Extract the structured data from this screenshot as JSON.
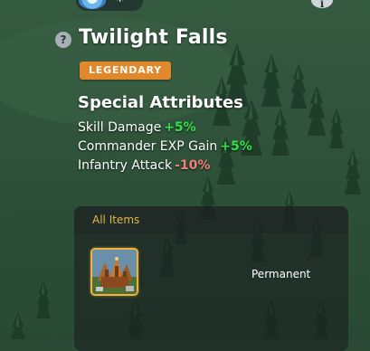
{
  "artifact": {
    "name": "Twilight Falls",
    "rarity": "LEGENDARY",
    "rarity_color": "#e0882a"
  },
  "attributes": {
    "heading": "Special Attributes",
    "items": [
      {
        "label": "Skill Damage",
        "value": "+5%",
        "color": "#35e04a"
      },
      {
        "label": "Commander EXP Gain",
        "value": "+5%",
        "color": "#35e04a"
      },
      {
        "label": "Infantry Attack",
        "value": "-10%",
        "color": "#f2807a"
      }
    ]
  },
  "inventory": {
    "tab_label": "All Items",
    "tab_color": "#e3b640",
    "entries": [
      {
        "icon": "fortress-icon",
        "status": "Permanent"
      }
    ]
  },
  "icons": {
    "help": "question-circle-icon",
    "info": "info-icon",
    "toggle": "snowflake-toggle-icon"
  }
}
